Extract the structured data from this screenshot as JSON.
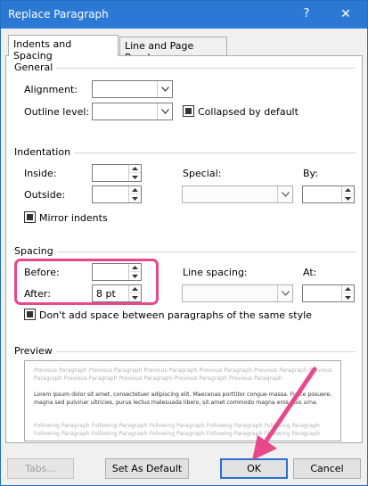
{
  "window": {
    "title": "Replace Paragraph",
    "help_glyph": "?",
    "close_glyph": "✕"
  },
  "tabs": [
    {
      "label": "Indents and Spacing",
      "active": true
    },
    {
      "label": "Line and Page Breaks",
      "active": false
    }
  ],
  "general": {
    "heading": "General",
    "alignment_label": "Alignment:",
    "alignment_value": "",
    "outline_label": "Outline level:",
    "outline_value": "",
    "collapsed_label": "Collapsed by default",
    "collapsed_checked": "indeterminate"
  },
  "indentation": {
    "heading": "Indentation",
    "inside_label": "Inside:",
    "inside_value": "",
    "outside_label": "Outside:",
    "outside_value": "",
    "special_label": "Special:",
    "special_value": "",
    "by_label": "By:",
    "by_value": "",
    "mirror_label": "Mirror indents",
    "mirror_checked": "indeterminate"
  },
  "spacing": {
    "heading": "Spacing",
    "before_label": "Before:",
    "before_value": "",
    "after_label": "After:",
    "after_value": "8 pt",
    "line_spacing_label": "Line spacing:",
    "line_spacing_value": "",
    "at_label": "At:",
    "at_value": "",
    "dont_add_label": "Don't add space between paragraphs of the same style",
    "dont_add_checked": "indeterminate"
  },
  "preview": {
    "heading": "Preview",
    "previous_text": "Previous Paragraph Previous Paragraph Previous Paragraph Previous Paragraph Previous Paragraph Previous Paragraph Previous Paragraph Previous Paragraph Previous Paragraph Previous Paragraph",
    "sample_text": "Lorem ipsum dolor sit amet, consectetuer adipiscing elit. Maecenas porttitor congue massa. Fusce posuere, magna sed pulvinar ultricies, purus lectus malesuada libero, sit amet commodo magna eros quis urna.",
    "following_text": "Following Paragraph Following Paragraph Following Paragraph Following Paragraph Following Paragraph Following Paragraph Following Paragraph Following Paragraph Following Paragraph Following Paragraph"
  },
  "buttons": {
    "tabs": "Tabs...",
    "set_default": "Set As Default",
    "ok": "OK",
    "cancel": "Cancel"
  },
  "colors": {
    "titlebar": "#2b79d4",
    "highlight": "#e9478b",
    "ok_border": "#2b6fd1"
  }
}
